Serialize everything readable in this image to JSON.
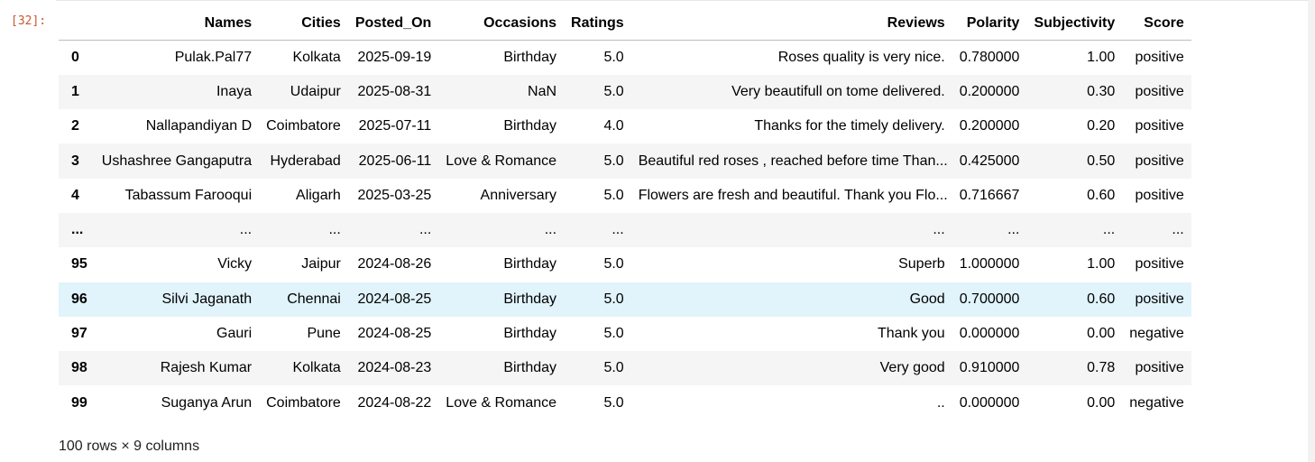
{
  "cell": {
    "prompt": "[32]:"
  },
  "table": {
    "columns": [
      "",
      "Names",
      "Cities",
      "Posted_On",
      "Occasions",
      "Ratings",
      "Reviews",
      "Polarity",
      "Subjectivity",
      "Score"
    ],
    "rows": [
      {
        "index": "0",
        "cells": [
          "Pulak.Pal77",
          "Kolkata",
          "2025-09-19",
          "Birthday",
          "5.0",
          "Roses quality is very nice.",
          "0.780000",
          "1.00",
          "positive"
        ]
      },
      {
        "index": "1",
        "cells": [
          "Inaya",
          "Udaipur",
          "2025-08-31",
          "NaN",
          "5.0",
          "Very beautifull on tome delivered.",
          "0.200000",
          "0.30",
          "positive"
        ]
      },
      {
        "index": "2",
        "cells": [
          "Nallapandiyan D",
          "Coimbatore",
          "2025-07-11",
          "Birthday",
          "4.0",
          "Thanks for the timely delivery.",
          "0.200000",
          "0.20",
          "positive"
        ]
      },
      {
        "index": "3",
        "cells": [
          "Ushashree Gangaputra",
          "Hyderabad",
          "2025-06-11",
          "Love & Romance",
          "5.0",
          "Beautiful red roses , reached before time Than...",
          "0.425000",
          "0.50",
          "positive"
        ]
      },
      {
        "index": "4",
        "cells": [
          "Tabassum Farooqui",
          "Aligarh",
          "2025-03-25",
          "Anniversary",
          "5.0",
          "Flowers are fresh and beautiful. Thank you Flo...",
          "0.716667",
          "0.60",
          "positive"
        ]
      },
      {
        "index": "...",
        "cells": [
          "...",
          "...",
          "...",
          "...",
          "...",
          "...",
          "...",
          "...",
          "..."
        ]
      },
      {
        "index": "95",
        "cells": [
          "Vicky",
          "Jaipur",
          "2024-08-26",
          "Birthday",
          "5.0",
          "Superb",
          "1.000000",
          "1.00",
          "positive"
        ]
      },
      {
        "index": "96",
        "cells": [
          "Silvi Jaganath",
          "Chennai",
          "2024-08-25",
          "Birthday",
          "5.0",
          "Good",
          "0.700000",
          "0.60",
          "positive"
        ]
      },
      {
        "index": "97",
        "cells": [
          "Gauri",
          "Pune",
          "2024-08-25",
          "Birthday",
          "5.0",
          "Thank you",
          "0.000000",
          "0.00",
          "negative"
        ]
      },
      {
        "index": "98",
        "cells": [
          "Rajesh Kumar",
          "Kolkata",
          "2024-08-23",
          "Birthday",
          "5.0",
          "Very good",
          "0.910000",
          "0.78",
          "positive"
        ]
      },
      {
        "index": "99",
        "cells": [
          "Suganya Arun",
          "Coimbatore",
          "2024-08-22",
          "Love & Romance",
          "5.0",
          "..",
          "0.000000",
          "0.00",
          "negative"
        ]
      }
    ],
    "shape_text": "100 rows × 9 columns"
  },
  "colors": {
    "prompt": "#c55a30",
    "stripe": "#f5f5f5",
    "hover": "#e1f3fb"
  }
}
